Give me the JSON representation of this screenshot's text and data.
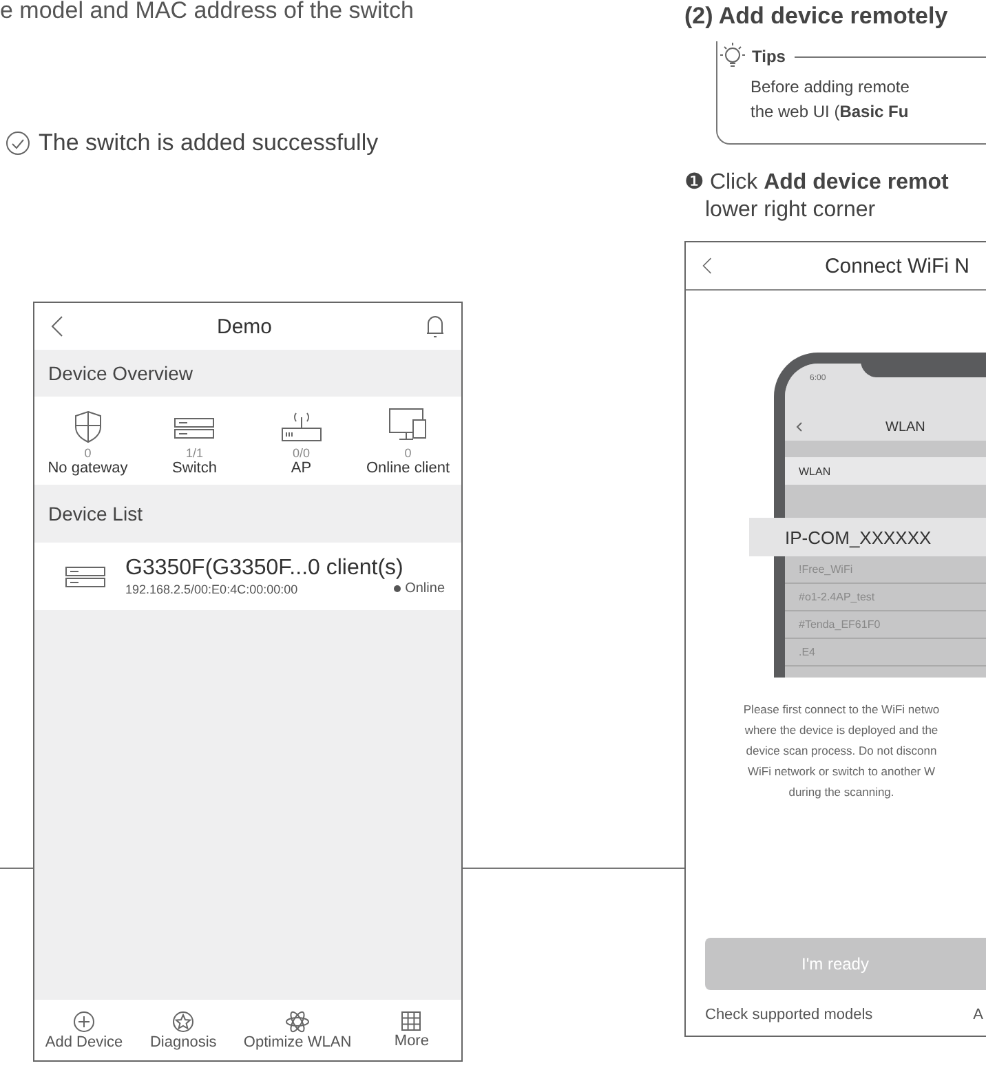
{
  "intro_line": "e model and MAC address of the switch",
  "result": "The switch is added successfully",
  "demo_screen": {
    "title": "Demo",
    "overview_title": "Device Overview",
    "overview": [
      {
        "kind": "gateway",
        "count": "0",
        "label": "No gateway"
      },
      {
        "kind": "switch",
        "count": "1/1",
        "label": "Switch"
      },
      {
        "kind": "ap",
        "count": "0/0",
        "label": "AP"
      },
      {
        "kind": "client",
        "count": "0",
        "label": "Online client"
      }
    ],
    "list_title": "Device List",
    "devices": [
      {
        "name": "G3350F(G3350F...0 client(s)",
        "address": "192.168.2.5/00:E0:4C:00:00:00",
        "status": "Online",
        "online": true
      }
    ],
    "nav": [
      {
        "kind": "add",
        "label": "Add Device"
      },
      {
        "kind": "diagnosis",
        "label": "Diagnosis"
      },
      {
        "kind": "optimize",
        "label": "Optimize WLAN"
      },
      {
        "kind": "more",
        "label": "More"
      }
    ]
  },
  "heading": "(2) Add device remotely",
  "tips": {
    "title": "Tips",
    "lines": [
      "Before adding remote",
      "the web UI (**Basic Fu**"
    ]
  },
  "step": {
    "marker": "❶",
    "lines": [
      "Click **Add device remot**",
      "lower right corner"
    ]
  },
  "wifi_screen": {
    "title": "Connect WiFi N",
    "phone": {
      "time": "6:00",
      "title": "WLAN",
      "toggle_label": "WLAN",
      "selected_network": "IP-COM_XXXXXX",
      "networks": [
        "!Free_WiFi",
        "#o1-2.4AP_test",
        "#Tenda_EF61F0",
        ".E4"
      ]
    },
    "instructions": [
      "Please first connect to the WiFi netwo",
      "where the device is deployed and the",
      "device scan process. Do not disconn",
      "WiFi network or switch to another W",
      "during the scanning."
    ],
    "button": "I'm ready",
    "footer_left": "Check supported models",
    "footer_right": "A"
  }
}
